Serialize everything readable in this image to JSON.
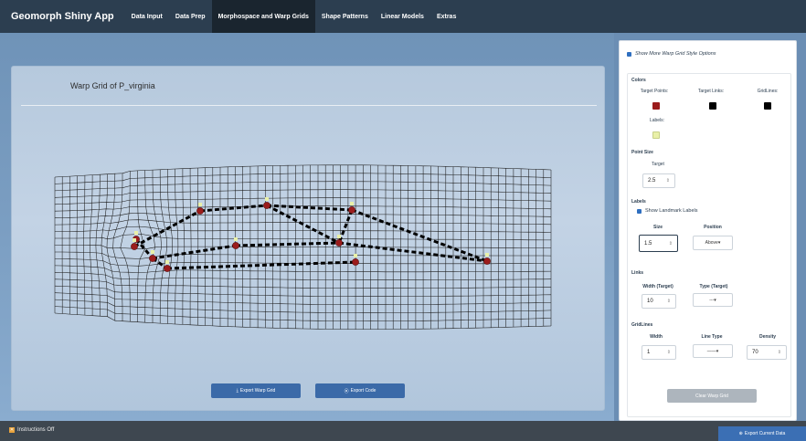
{
  "navbar": {
    "brand": "Geomorph Shiny App",
    "tabs": [
      "Data Input",
      "Data Prep",
      "Morphospace and Warp Grids",
      "Shape Patterns",
      "Linear Models",
      "Extras"
    ],
    "active_index": 2
  },
  "plot": {
    "title": "Warp Grid of P_virginia",
    "export_warp_label": "Export Warp Grid",
    "export_code_label": "Export Code"
  },
  "sidebar": {
    "show_more_label": "Show More Warp Grid Style Options",
    "colors": {
      "heading": "Colors",
      "target_points_label": "Target Points:",
      "target_links_label": "Target Links:",
      "gridlines_label": "GridLines:",
      "labels_label": "Labels:",
      "target_points_color": "#9b1c1c",
      "target_links_color": "#000000",
      "gridlines_color": "#000000",
      "labels_color": "#e9f0a8"
    },
    "point_size": {
      "heading": "Point Size",
      "target_label": "Target",
      "target_value": "2.5"
    },
    "labels": {
      "heading": "Labels",
      "show_landmark_label": "Show Landmark Labels",
      "size_label": "Size",
      "size_value": "1.5",
      "position_label": "Position",
      "position_value": "Above"
    },
    "links": {
      "heading": "Links",
      "width_label": "Width (Target)",
      "width_value": "10",
      "type_label": "Type (Target)",
      "type_value": "---"
    },
    "gridlines": {
      "heading": "GridLines",
      "width_label": "Width",
      "width_value": "1",
      "line_type_label": "Line Type",
      "line_type_value": "——",
      "density_label": "Density",
      "density_value": "70"
    },
    "clear_label": "Clear Warp Grid"
  },
  "footer": {
    "instructions_label": "Instructions Off",
    "export_label": "Export Current Data"
  },
  "icons": {
    "download": "download-icon",
    "code": "code-icon",
    "spin": "spinner-arrows-icon",
    "caret": "caret-down-icon"
  }
}
